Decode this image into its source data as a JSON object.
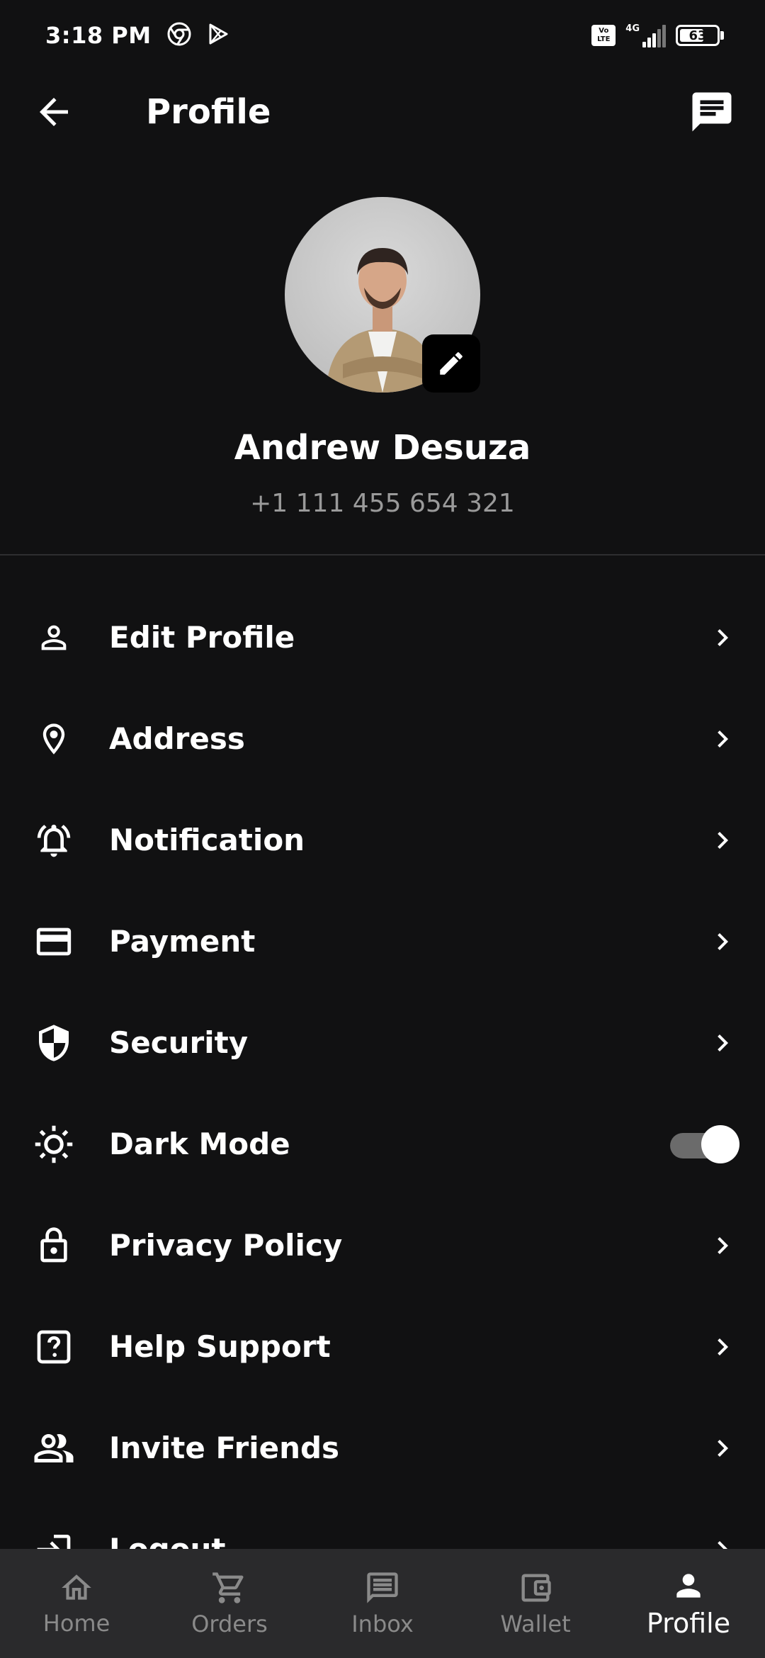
{
  "status_bar": {
    "time": "3:18 PM",
    "network": "4G",
    "volte": "Vo LTE",
    "battery_level": "63"
  },
  "header": {
    "title": "Profile"
  },
  "profile": {
    "name": "Andrew Desuza",
    "phone": "+1 111 455 654 321"
  },
  "menu": {
    "items": [
      {
        "label": "Edit Profile",
        "icon": "person-icon"
      },
      {
        "label": "Address",
        "icon": "location-pin-icon"
      },
      {
        "label": "Notification",
        "icon": "bell-icon"
      },
      {
        "label": "Payment",
        "icon": "credit-card-icon"
      },
      {
        "label": "Security",
        "icon": "shield-icon"
      },
      {
        "label": "Dark Mode",
        "icon": "sun-icon",
        "toggle_on": true
      },
      {
        "label": "Privacy Policy",
        "icon": "lock-icon"
      },
      {
        "label": "Help Support",
        "icon": "help-icon"
      },
      {
        "label": "Invite Friends",
        "icon": "people-icon"
      },
      {
        "label": "Logout",
        "icon": "logout-icon"
      }
    ]
  },
  "bottom_nav": {
    "items": [
      {
        "label": "Home",
        "icon": "home-icon"
      },
      {
        "label": "Orders",
        "icon": "cart-icon"
      },
      {
        "label": "Inbox",
        "icon": "inbox-icon"
      },
      {
        "label": "Wallet",
        "icon": "wallet-icon"
      },
      {
        "label": "Profile",
        "icon": "profile-icon",
        "active": true
      }
    ]
  },
  "colors": {
    "background": "#111112",
    "nav_background": "#2a2a2c",
    "muted_text": "#9a9a9a",
    "inactive_nav": "#8a8a8a"
  }
}
